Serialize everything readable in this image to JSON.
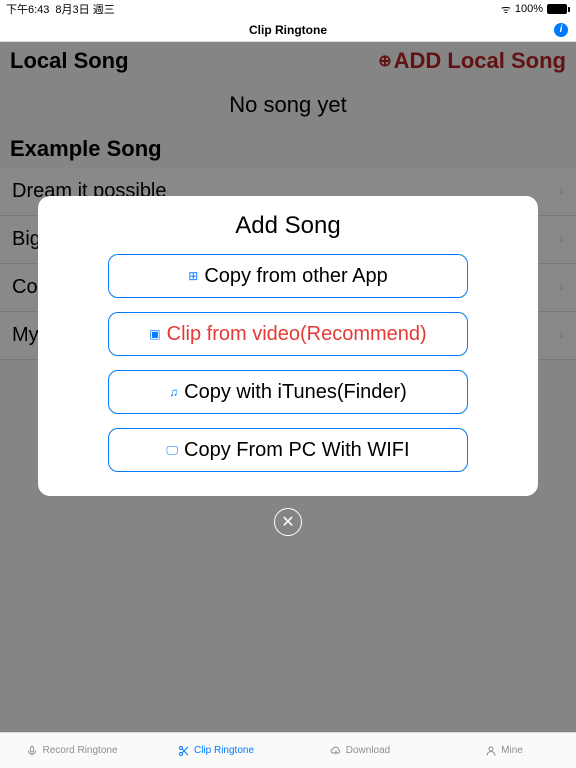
{
  "status": {
    "time": "下午6:43",
    "date": "8月3日 週三",
    "wifi_glyph": "ᯤ",
    "battery_pct": "100%"
  },
  "nav": {
    "title": "Clip Ringtone"
  },
  "sections": {
    "local": {
      "title": "Local Song",
      "add_label": "ADD Local Song",
      "empty": "No song yet"
    },
    "example": {
      "title": "Example Song",
      "items": [
        "Dream it possible",
        "Big big world",
        "Country road",
        "My heart will go on"
      ]
    }
  },
  "modal": {
    "title": "Add Song",
    "options": [
      {
        "label": "Copy from other App",
        "highlight": false
      },
      {
        "label": "Clip from video(Recommend)",
        "highlight": true
      },
      {
        "label": "Copy with iTunes(Finder)",
        "highlight": false
      },
      {
        "label": "Copy From PC With WIFI",
        "highlight": false
      }
    ]
  },
  "tabs": [
    {
      "label": "Record Ringtone",
      "active": false
    },
    {
      "label": "Clip Ringtone",
      "active": true
    },
    {
      "label": "Download",
      "active": false
    },
    {
      "label": "Mine",
      "active": false
    }
  ]
}
